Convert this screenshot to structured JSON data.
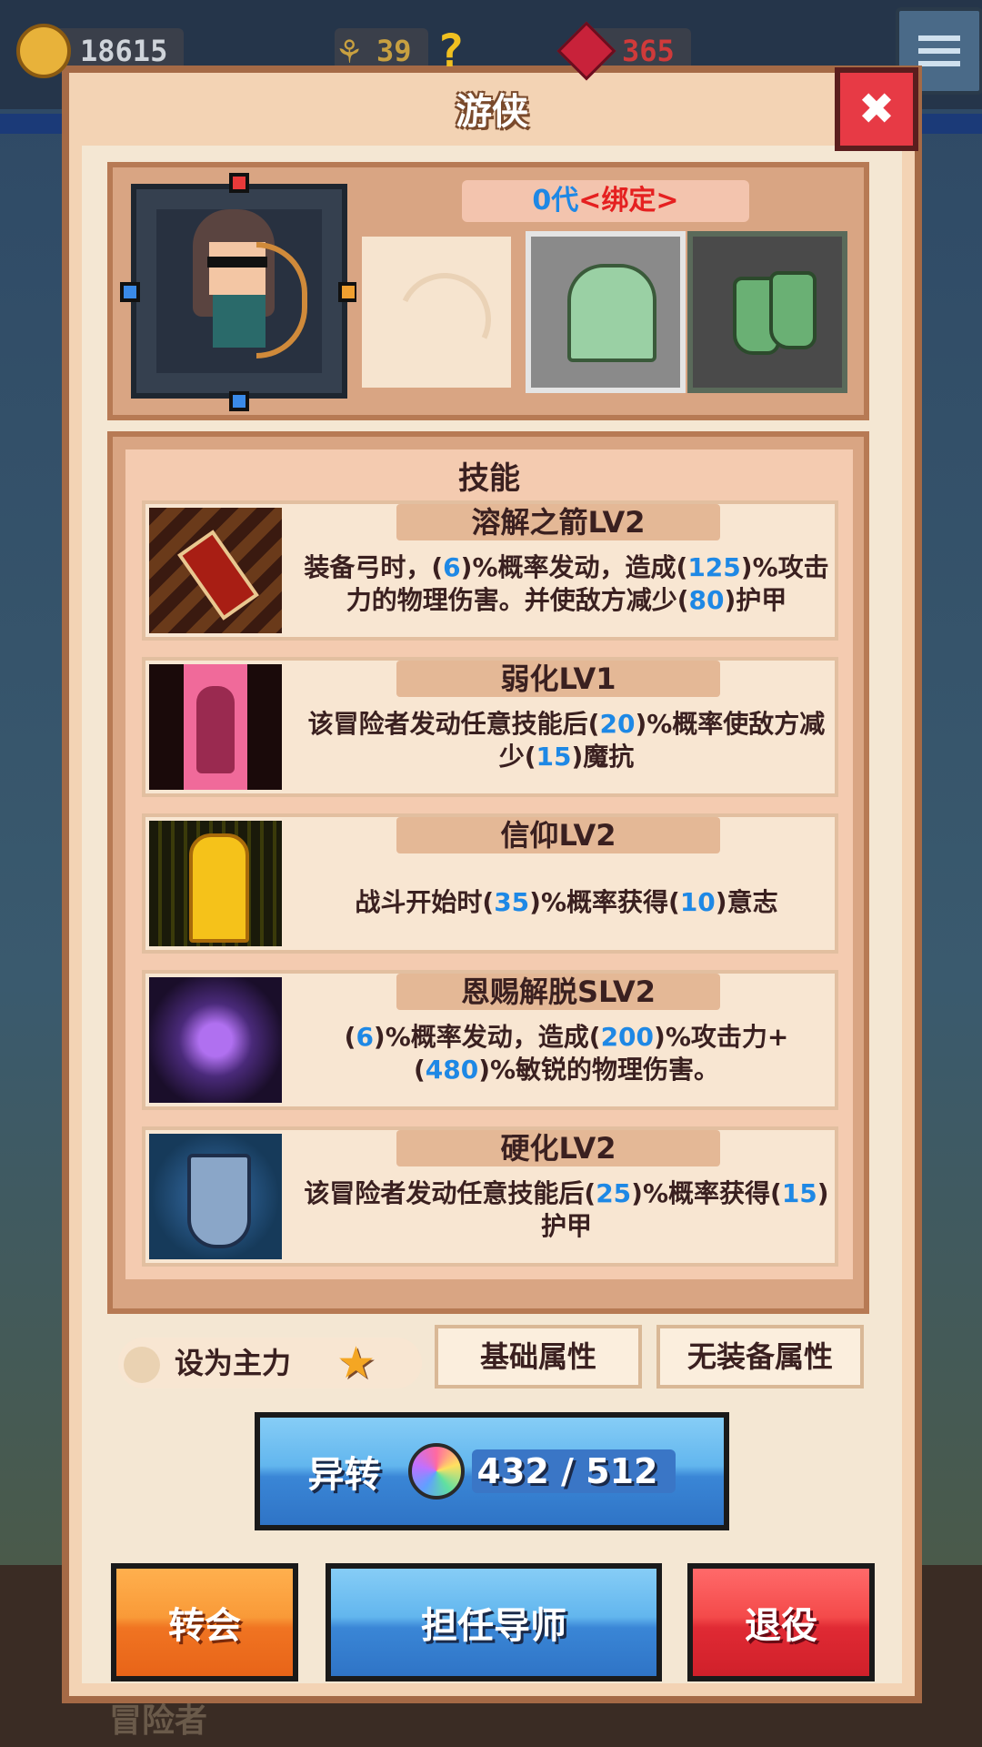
{
  "topbar": {
    "gold": "18615",
    "wheat": "39",
    "gems": "365"
  },
  "panel": {
    "title": "游侠",
    "generation": "0代",
    "binding": "<绑定>"
  },
  "skills": {
    "title": "技能",
    "items": [
      {
        "name": "溶解之箭LV2",
        "desc": [
          {
            "t": "装备弓时，("
          },
          {
            "n": "6"
          },
          {
            "t": ")%概率发动，造成("
          },
          {
            "n": "125"
          },
          {
            "t": ")%攻击力的物理伤害。并使敌方减少("
          },
          {
            "n": "80"
          },
          {
            "t": ")护甲"
          }
        ]
      },
      {
        "name": "弱化LV1",
        "desc": [
          {
            "t": "该冒险者发动任意技能后("
          },
          {
            "n": "20"
          },
          {
            "t": ")%概率使敌方减少("
          },
          {
            "n": "15"
          },
          {
            "t": ")魔抗"
          }
        ]
      },
      {
        "name": "信仰LV2",
        "desc": [
          {
            "t": "战斗开始时("
          },
          {
            "n": "35"
          },
          {
            "t": ")%概率获得("
          },
          {
            "n": "10"
          },
          {
            "t": ")意志"
          }
        ]
      },
      {
        "name": "恩赐解脱SLV2",
        "desc": [
          {
            "t": "("
          },
          {
            "n": "6"
          },
          {
            "t": ")%概率发动，造成("
          },
          {
            "n": "200"
          },
          {
            "t": ")%攻击力+("
          },
          {
            "n": "480"
          },
          {
            "t": ")%敏锐的物理伤害。"
          }
        ]
      },
      {
        "name": "硬化LV2",
        "desc": [
          {
            "t": "该冒险者发动任意技能后("
          },
          {
            "n": "25"
          },
          {
            "t": ")%概率获得("
          },
          {
            "n": "15"
          },
          {
            "t": ")护甲"
          }
        ]
      }
    ]
  },
  "controls": {
    "set_main": "设为主力",
    "base_attrs": "基础属性",
    "no_equip_attrs": "无装备属性",
    "transform": "异转",
    "transform_count": "432 / 512",
    "transfer": "转会",
    "mentor": "担任导师",
    "retire": "退役"
  },
  "background": {
    "peek_label": "冒险者"
  },
  "colors": {
    "number_blue": "#1e88e5",
    "bind_red": "#e52020",
    "button_blue": "#3a86d6",
    "button_orange": "#f07422",
    "button_red": "#e02a34"
  }
}
